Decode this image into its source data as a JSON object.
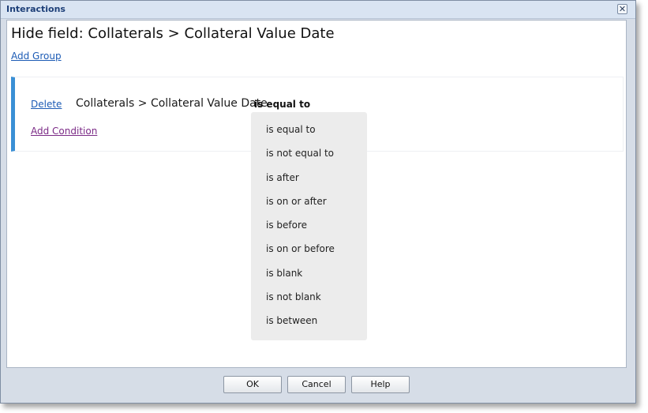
{
  "window": {
    "title": "Interactions",
    "close_symbol": "✕",
    "close_icon": "close-icon"
  },
  "heading": "Hide field: Collaterals > Collateral Value Date",
  "add_group_label": "Add Group",
  "condition": {
    "delete_label": "Delete",
    "field": "Collaterals > Collateral Value Date",
    "operator": "is equal to"
  },
  "add_condition_label": "Add Condition",
  "operator_options": [
    "is equal to",
    "is not equal to",
    "is after",
    "is on or after",
    "is before",
    "is on or before",
    "is blank",
    "is not blank",
    "is between"
  ],
  "buttons": {
    "ok": "OK",
    "cancel": "Cancel",
    "help": "Help"
  },
  "colors": {
    "accent_bar": "#3a8fd5",
    "link": "#1c5bb5",
    "visited_link": "#7b2a86",
    "title_text": "#1d3f78"
  }
}
